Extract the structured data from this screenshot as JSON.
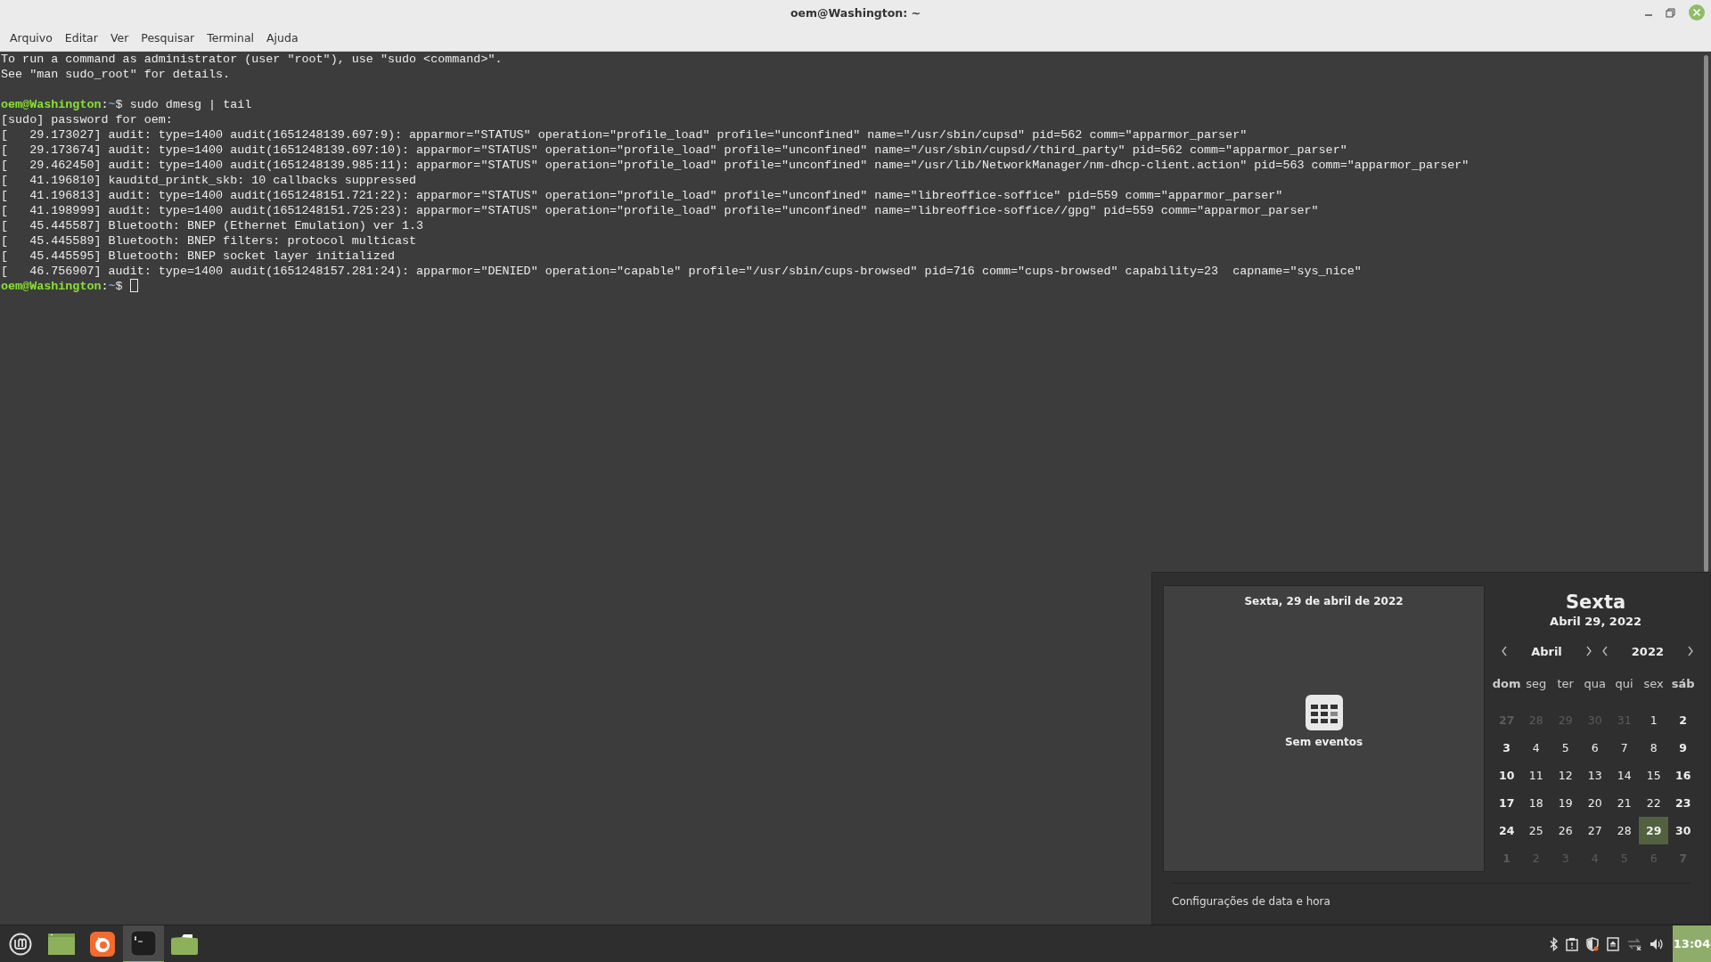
{
  "window": {
    "title": "oem@Washington: ~"
  },
  "menu": [
    "Arquivo",
    "Editar",
    "Ver",
    "Pesquisar",
    "Terminal",
    "Ajuda"
  ],
  "terminal": {
    "lines": [
      {
        "kind": "output",
        "text": "To run a command as administrator (user \"root\"), use \"sudo <command>\"."
      },
      {
        "kind": "output",
        "text": "See \"man sudo_root\" for details."
      },
      {
        "kind": "blank"
      },
      {
        "kind": "prompt",
        "user": "oem@Washington",
        "sep": ":",
        "path": "~",
        "symbol": "$",
        "command": "sudo dmesg | tail"
      },
      {
        "kind": "output",
        "text": "[sudo] password for oem:"
      },
      {
        "kind": "output",
        "text": "[   29.173027] audit: type=1400 audit(1651248139.697:9): apparmor=\"STATUS\" operation=\"profile_load\" profile=\"unconfined\" name=\"/usr/sbin/cupsd\" pid=562 comm=\"apparmor_parser\""
      },
      {
        "kind": "output",
        "text": "[   29.173674] audit: type=1400 audit(1651248139.697:10): apparmor=\"STATUS\" operation=\"profile_load\" profile=\"unconfined\" name=\"/usr/sbin/cupsd//third_party\" pid=562 comm=\"apparmor_parser\""
      },
      {
        "kind": "output",
        "text": "[   29.462450] audit: type=1400 audit(1651248139.985:11): apparmor=\"STATUS\" operation=\"profile_load\" profile=\"unconfined\" name=\"/usr/lib/NetworkManager/nm-dhcp-client.action\" pid=563 comm=\"apparmor_parser\""
      },
      {
        "kind": "output",
        "text": "[   41.196810] kauditd_printk_skb: 10 callbacks suppressed"
      },
      {
        "kind": "output",
        "text": "[   41.196813] audit: type=1400 audit(1651248151.721:22): apparmor=\"STATUS\" operation=\"profile_load\" profile=\"unconfined\" name=\"libreoffice-soffice\" pid=559 comm=\"apparmor_parser\""
      },
      {
        "kind": "output",
        "text": "[   41.198999] audit: type=1400 audit(1651248151.725:23): apparmor=\"STATUS\" operation=\"profile_load\" profile=\"unconfined\" name=\"libreoffice-soffice//gpg\" pid=559 comm=\"apparmor_parser\""
      },
      {
        "kind": "output",
        "text": "[   45.445587] Bluetooth: BNEP (Ethernet Emulation) ver 1.3"
      },
      {
        "kind": "output",
        "text": "[   45.445589] Bluetooth: BNEP filters: protocol multicast"
      },
      {
        "kind": "output",
        "text": "[   45.445595] Bluetooth: BNEP socket layer initialized"
      },
      {
        "kind": "output",
        "text": "[   46.756907] audit: type=1400 audit(1651248157.281:24): apparmor=\"DENIED\" operation=\"capable\" profile=\"/usr/sbin/cups-browsed\" pid=716 comm=\"cups-browsed\" capability=23  capname=\"sys_nice\""
      },
      {
        "kind": "prompt",
        "user": "oem@Washington",
        "sep": ":",
        "path": "~",
        "symbol": "$",
        "cursor": true
      }
    ]
  },
  "calendar": {
    "events_header": "Sexta, 29 de abril de 2022",
    "empty_text": "Sem eventos",
    "day_name": "Sexta",
    "date": "Abril 29, 2022",
    "month": "Abril",
    "year": "2022",
    "weekdays": [
      {
        "label": "dom",
        "weekend": true
      },
      {
        "label": "seg",
        "weekend": false
      },
      {
        "label": "ter",
        "weekend": false
      },
      {
        "label": "qua",
        "weekend": false
      },
      {
        "label": "qui",
        "weekend": false
      },
      {
        "label": "sex",
        "weekend": false
      },
      {
        "label": "sáb",
        "weekend": true
      }
    ],
    "weeks": [
      [
        {
          "label": "27",
          "other_month": true,
          "selected": false
        },
        {
          "label": "28",
          "other_month": true,
          "selected": false
        },
        {
          "label": "29",
          "other_month": true,
          "selected": false
        },
        {
          "label": "30",
          "other_month": true,
          "selected": false
        },
        {
          "label": "31",
          "other_month": true,
          "selected": false
        },
        {
          "label": "1",
          "other_month": false,
          "selected": false
        },
        {
          "label": "2",
          "other_month": false,
          "selected": false
        }
      ],
      [
        {
          "label": "3",
          "other_month": false,
          "selected": false
        },
        {
          "label": "4",
          "other_month": false,
          "selected": false
        },
        {
          "label": "5",
          "other_month": false,
          "selected": false
        },
        {
          "label": "6",
          "other_month": false,
          "selected": false
        },
        {
          "label": "7",
          "other_month": false,
          "selected": false
        },
        {
          "label": "8",
          "other_month": false,
          "selected": false
        },
        {
          "label": "9",
          "other_month": false,
          "selected": false
        }
      ],
      [
        {
          "label": "10",
          "other_month": false,
          "selected": false
        },
        {
          "label": "11",
          "other_month": false,
          "selected": false
        },
        {
          "label": "12",
          "other_month": false,
          "selected": false
        },
        {
          "label": "13",
          "other_month": false,
          "selected": false
        },
        {
          "label": "14",
          "other_month": false,
          "selected": false
        },
        {
          "label": "15",
          "other_month": false,
          "selected": false
        },
        {
          "label": "16",
          "other_month": false,
          "selected": false
        }
      ],
      [
        {
          "label": "17",
          "other_month": false,
          "selected": false
        },
        {
          "label": "18",
          "other_month": false,
          "selected": false
        },
        {
          "label": "19",
          "other_month": false,
          "selected": false
        },
        {
          "label": "20",
          "other_month": false,
          "selected": false
        },
        {
          "label": "21",
          "other_month": false,
          "selected": false
        },
        {
          "label": "22",
          "other_month": false,
          "selected": false
        },
        {
          "label": "23",
          "other_month": false,
          "selected": false
        }
      ],
      [
        {
          "label": "24",
          "other_month": false,
          "selected": false
        },
        {
          "label": "25",
          "other_month": false,
          "selected": false
        },
        {
          "label": "26",
          "other_month": false,
          "selected": false
        },
        {
          "label": "27",
          "other_month": false,
          "selected": false
        },
        {
          "label": "28",
          "other_month": false,
          "selected": false
        },
        {
          "label": "29",
          "other_month": false,
          "selected": true
        },
        {
          "label": "30",
          "other_month": false,
          "selected": false
        }
      ],
      [
        {
          "label": "1",
          "other_month": true,
          "selected": false
        },
        {
          "label": "2",
          "other_month": true,
          "selected": false
        },
        {
          "label": "3",
          "other_month": true,
          "selected": false
        },
        {
          "label": "4",
          "other_month": true,
          "selected": false
        },
        {
          "label": "5",
          "other_month": true,
          "selected": false
        },
        {
          "label": "6",
          "other_month": true,
          "selected": false
        },
        {
          "label": "7",
          "other_month": true,
          "selected": false
        }
      ]
    ],
    "settings_link": "Configurações de data e hora"
  },
  "taskbar": {
    "apps": [
      {
        "kind": "desktop",
        "active": false
      },
      {
        "kind": "firefox",
        "active": false
      },
      {
        "kind": "terminal",
        "active": true
      },
      {
        "kind": "folder",
        "active": false
      }
    ],
    "tray": [
      {
        "kind": "bluetooth"
      },
      {
        "kind": "clipboard"
      },
      {
        "kind": "shield"
      },
      {
        "kind": "eject"
      },
      {
        "kind": "network"
      },
      {
        "kind": "volume"
      }
    ],
    "clock": "13:04"
  }
}
